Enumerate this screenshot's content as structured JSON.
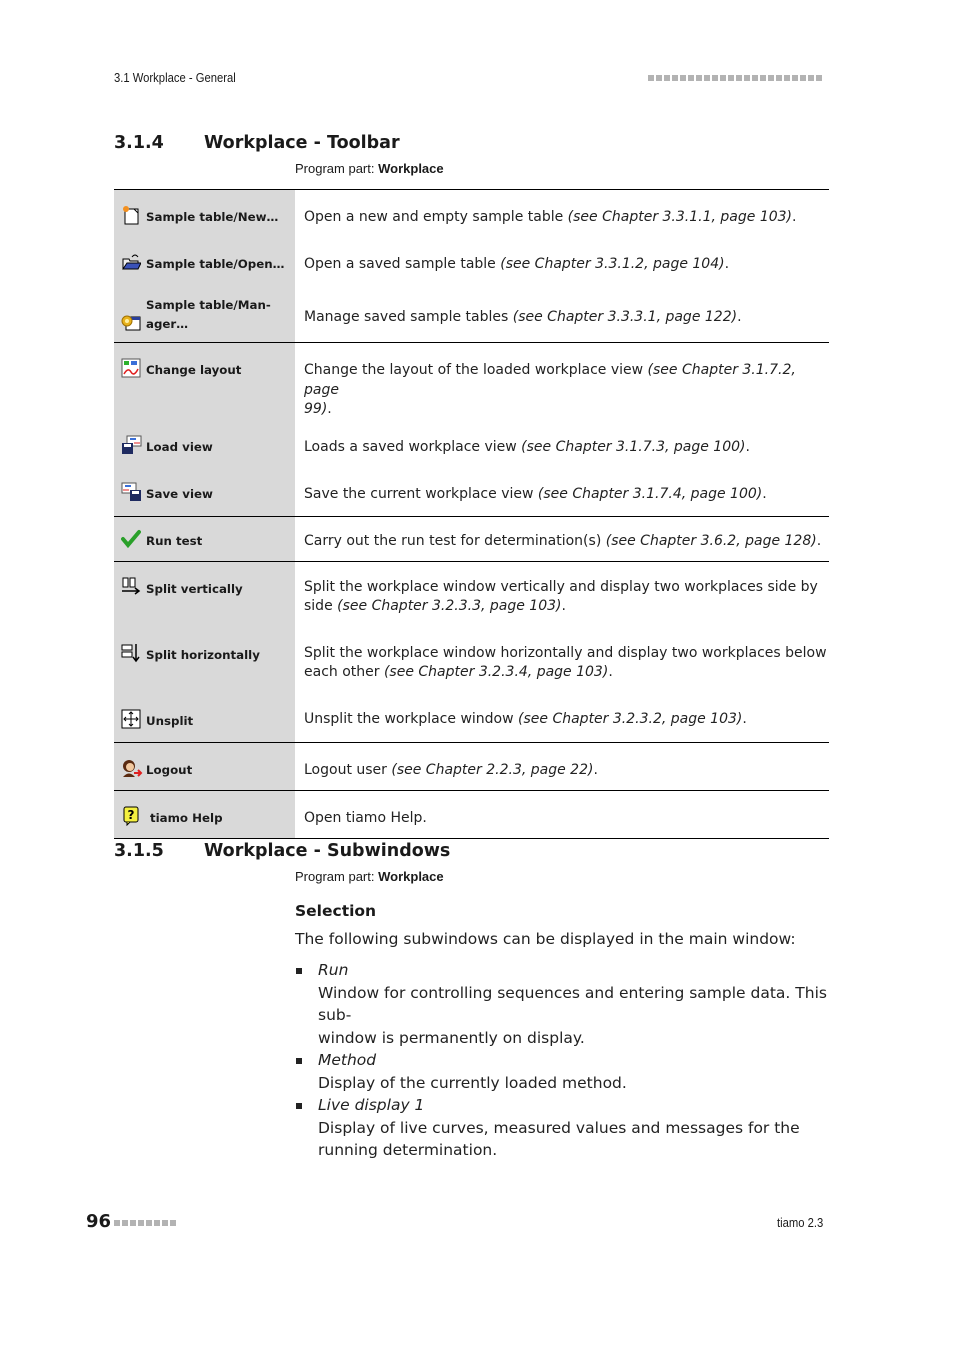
{
  "header": {
    "running_title": "3.1 Workplace - General"
  },
  "section1": {
    "number": "3.1.4",
    "title": "Workplace - Toolbar",
    "program_part_label": "Program part:",
    "program_part_value": "Workplace"
  },
  "toolbar_table": {
    "rows": [
      {
        "icon": "new-sample-table-icon",
        "label": "Sample table/New…",
        "desc": "Open a new and empty sample table ",
        "ref": "(see Chapter 3.3.1.1, page 103)",
        "end": "."
      },
      {
        "icon": "open-sample-table-icon",
        "label": "Sample table/Open…",
        "desc": "Open a saved sample table ",
        "ref": "(see Chapter 3.3.1.2, page 104)",
        "end": "."
      },
      {
        "icon": "manage-sample-table-icon",
        "label": "Sample table/Man-ager…",
        "label_l1": "Sample table/Man-",
        "label_l2": "ager…",
        "desc": "Manage saved sample tables ",
        "ref": "(see Chapter 3.3.3.1, page 122)",
        "end": "."
      },
      {
        "icon": "change-layout-icon",
        "label": "Change layout",
        "desc": "Change the layout of the loaded workplace view ",
        "ref": "(see Chapter 3.1.7.2, page 99)",
        "ref_l1": "(see Chapter 3.1.7.2, page",
        "ref_l2": "99)",
        "end": "."
      },
      {
        "icon": "load-view-icon",
        "label": "Load view",
        "desc": "Loads a saved workplace view ",
        "ref": "(see Chapter 3.1.7.3, page 100)",
        "end": "."
      },
      {
        "icon": "save-view-icon",
        "label": "Save view",
        "desc": "Save the current workplace view ",
        "ref": "(see Chapter 3.1.7.4, page 100)",
        "end": "."
      },
      {
        "icon": "run-test-checkmark-icon",
        "label": "Run test",
        "desc": "Carry out the run test for determination(s) ",
        "ref": "(see Chapter 3.6.2, page 128)",
        "end": "."
      },
      {
        "icon": "split-vertically-icon",
        "label": "Split vertically",
        "desc": "Split the workplace window vertically and display two workplaces side by side ",
        "ref": "(see Chapter 3.2.3.3, page 103)",
        "end": "."
      },
      {
        "icon": "split-horizontally-icon",
        "label": "Split horizontally",
        "desc": "Split the workplace window horizontally and display two workplaces below each other ",
        "ref": "(see Chapter 3.2.3.4, page 103)",
        "end": "."
      },
      {
        "icon": "unsplit-icon",
        "label": "Unsplit",
        "desc": "Unsplit the workplace window ",
        "ref": "(see Chapter 3.2.3.2, page 103)",
        "end": "."
      },
      {
        "icon": "logout-user-icon",
        "label": "Logout",
        "desc": "Logout user ",
        "ref": "(see Chapter 2.2.3, page 22)",
        "end": "."
      },
      {
        "icon": "help-question-icon",
        "label": "tiamo Help",
        "desc": "Open tiamo Help.",
        "ref": "",
        "end": ""
      }
    ]
  },
  "section2": {
    "number": "3.1.5",
    "title": "Workplace - Subwindows",
    "program_part_label": "Program part:",
    "program_part_value": "Workplace",
    "selection_heading": "Selection",
    "intro": "The following subwindows can be displayed in the main window:",
    "items": [
      {
        "term": "Run",
        "desc": "Window for controlling sequences and entering sample data. This sub-window is permanently on display.",
        "desc_l1": "Window for controlling sequences and entering sample data. This sub-",
        "desc_l2": "window is permanently on display."
      },
      {
        "term": "Method",
        "desc": "Display of the currently loaded method."
      },
      {
        "term": "Live display 1",
        "desc": "Display of live curves, measured values and messages for the running determination."
      }
    ]
  },
  "footer": {
    "page_number": "96",
    "product": "tiamo 2.3"
  }
}
